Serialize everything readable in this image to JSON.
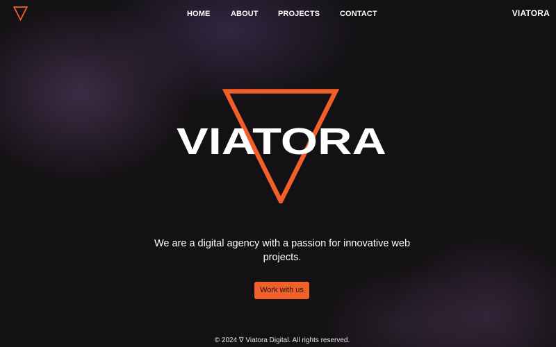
{
  "colors": {
    "accent": "#f0602a",
    "background": "#131113",
    "text": "#ffffff"
  },
  "nav": {
    "logo_icon": "inverted-triangle-icon",
    "links": [
      {
        "label": "HOME"
      },
      {
        "label": "ABOUT"
      },
      {
        "label": "PROJECTS"
      },
      {
        "label": "CONTACT"
      }
    ],
    "brand": "VIATORA"
  },
  "hero": {
    "logo_text": "VIATORA",
    "logo_icon": "inverted-triangle-icon",
    "tagline": "We are a digital agency with a passion for innovative web projects.",
    "cta_label": "Work with us"
  },
  "footer": {
    "text": "© 2024 ∇ Viatora Digital. All rights reserved."
  }
}
